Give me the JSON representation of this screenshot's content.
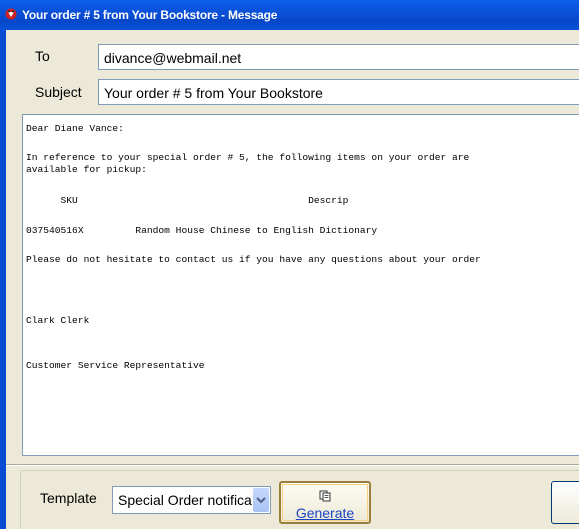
{
  "window": {
    "title": "Your order # 5 from Your Bookstore - Message",
    "app_icon": "app-logo-icon"
  },
  "to": {
    "label": "To",
    "value": "divance@webmail.net"
  },
  "subject": {
    "label": "Subject",
    "value": "Your order # 5 from Your Bookstore"
  },
  "message": {
    "lines": [
      "Dear Diane Vance:",
      "In reference to your special order # 5, the following items on your order are",
      "available for pickup:",
      "      SKU                                        Descrip",
      "037540516X         Random House Chinese to English Dictionary",
      "Please do not hesitate to contact us if you have any questions about your order",
      "Clark Clerk",
      "Customer Service Representative"
    ]
  },
  "footer": {
    "template_label": "Template",
    "template_value": "Special Order notification",
    "generate_label": "Generate",
    "generate_icon": "copy-icon",
    "dropdown_icon": "chevron-down-icon"
  },
  "colors": {
    "titlebar": "#0a4fd6",
    "window_bg": "#ece9d8",
    "field_border": "#7f9db9"
  }
}
